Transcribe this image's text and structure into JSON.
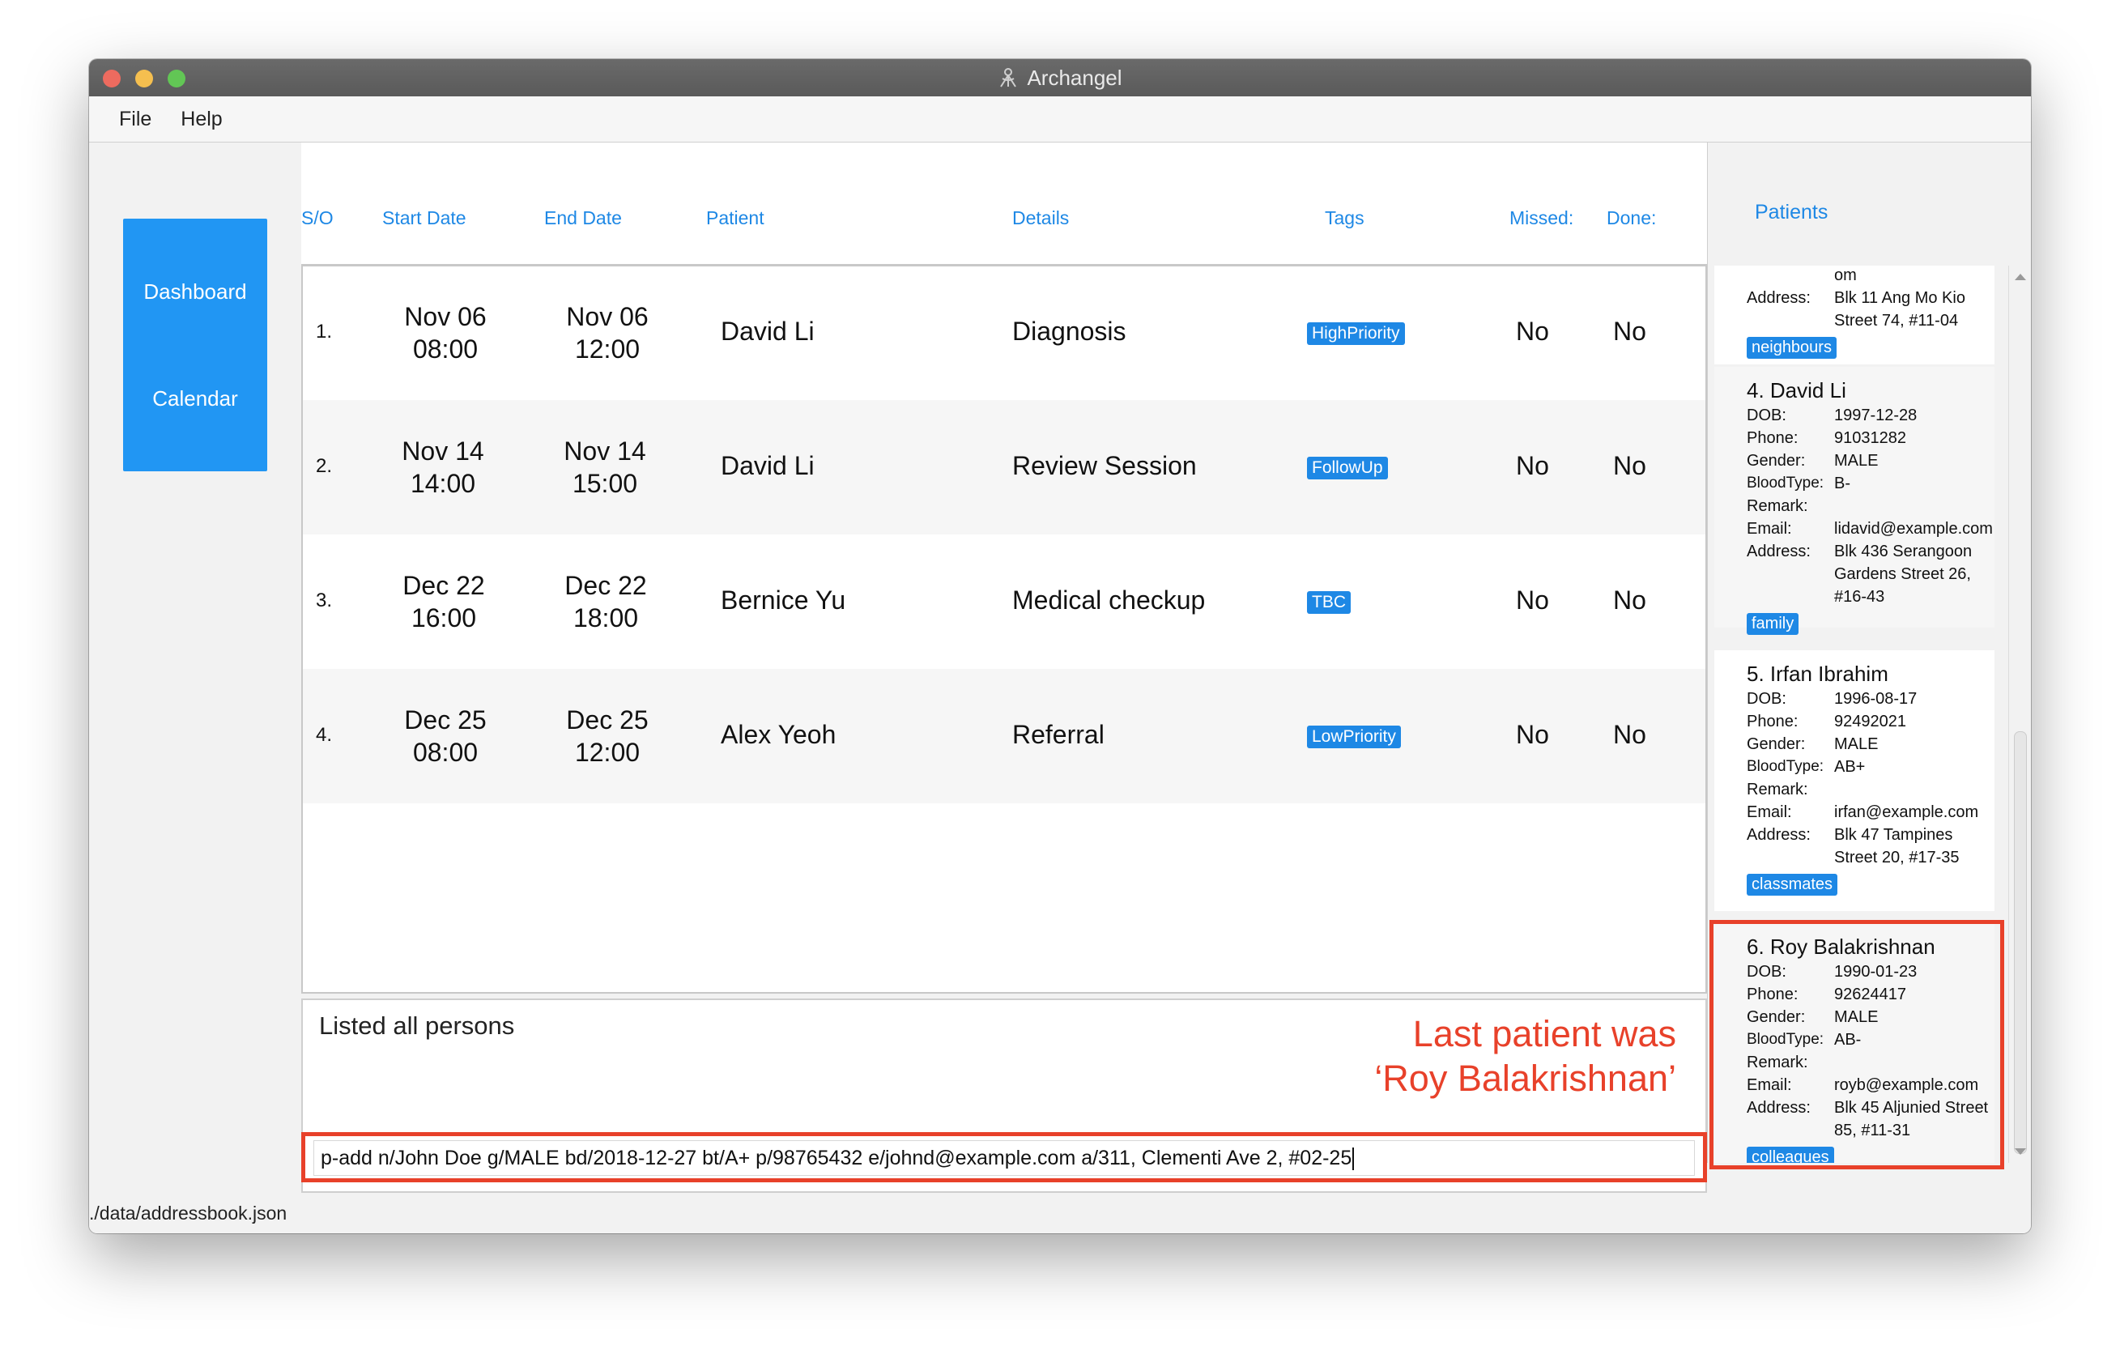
{
  "window": {
    "title": "Archangel"
  },
  "menu": [
    "File",
    "Help"
  ],
  "nav": {
    "dashboard": "Dashboard",
    "calendar": "Calendar"
  },
  "appointments": {
    "headers": {
      "so": "S/O",
      "start": "Start Date",
      "end": "End Date",
      "patient": "Patient",
      "details": "Details",
      "tags": "Tags",
      "missed": "Missed:",
      "done": "Done:"
    },
    "rows": [
      {
        "index": "1.",
        "start_date": "Nov 06",
        "start_time": "08:00",
        "end_date": "Nov 06",
        "end_time": "12:00",
        "patient": "David Li",
        "details": "Diagnosis",
        "tag": "HighPriority",
        "missed": "No",
        "done": "No"
      },
      {
        "index": "2.",
        "start_date": "Nov 14",
        "start_time": "14:00",
        "end_date": "Nov 14",
        "end_time": "15:00",
        "patient": "David Li",
        "details": "Review Session",
        "tag": "FollowUp",
        "missed": "No",
        "done": "No"
      },
      {
        "index": "3.",
        "start_date": "Dec 22",
        "start_time": "16:00",
        "end_date": "Dec 22",
        "end_time": "18:00",
        "patient": "Bernice Yu",
        "details": "Medical checkup",
        "tag": "TBC",
        "missed": "No",
        "done": "No"
      },
      {
        "index": "4.",
        "start_date": "Dec 25",
        "start_time": "08:00",
        "end_date": "Dec 25",
        "end_time": "12:00",
        "patient": "Alex Yeoh",
        "details": "Referral",
        "tag": "LowPriority",
        "missed": "No",
        "done": "No"
      }
    ]
  },
  "result": {
    "text": "Listed all persons"
  },
  "annotation": {
    "line1": "Last patient was",
    "line2": "‘Roy Balakrishnan’"
  },
  "command": {
    "value": "p-add n/John Doe g/MALE bd/2018-12-27 bt/A+ p/98765432 e/johnd@example.com a/311, Clementi Ave 2, #02-25"
  },
  "patients": {
    "title": "Patients",
    "labels": {
      "dob": "DOB:",
      "phone": "Phone:",
      "gender": "Gender:",
      "blood": "BloodType:",
      "remark": "Remark:",
      "email": "Email:",
      "address": "Address:"
    },
    "partial": {
      "email_tail": "om",
      "address_lines": [
        "Blk 11 Ang Mo Kio",
        "Street 74, #11-04"
      ],
      "tag": "neighbours"
    },
    "cards": [
      {
        "name": "4. David Li",
        "dob": "1997-12-28",
        "phone": "91031282",
        "gender": "MALE",
        "blood": "B-",
        "remark": "",
        "email": "lidavid@example.com",
        "address_lines": [
          "Blk 436 Serangoon",
          "Gardens Street 26,",
          "#16-43"
        ],
        "tag": "family"
      },
      {
        "name": "5. Irfan Ibrahim",
        "dob": "1996-08-17",
        "phone": "92492021",
        "gender": "MALE",
        "blood": "AB+",
        "remark": "",
        "email": "irfan@example.com",
        "address_lines": [
          "Blk 47 Tampines",
          "Street 20, #17-35"
        ],
        "tag": "classmates"
      },
      {
        "name": "6. Roy Balakrishnan",
        "dob": "1990-01-23",
        "phone": "92624417",
        "gender": "MALE",
        "blood": "AB-",
        "remark": "",
        "email": "royb@example.com",
        "address_lines": [
          "Blk 45 Aljunied Street",
          "85, #11-31"
        ],
        "tag": "colleagues"
      }
    ]
  },
  "status": {
    "path": "./data/addressbook.json"
  },
  "colors": {
    "accent": "#1e88e5",
    "button": "#2196f3",
    "highlight": "#e8412a"
  }
}
